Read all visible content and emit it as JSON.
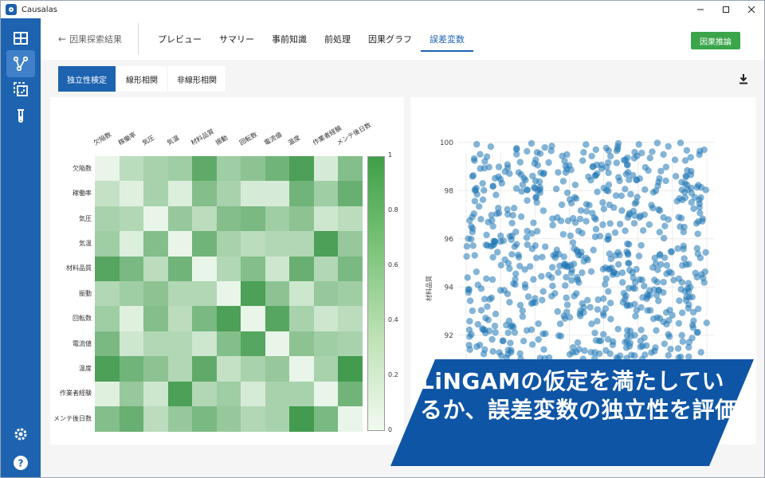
{
  "window": {
    "title": "Causalas"
  },
  "header": {
    "back_label": "因果探索結果",
    "tabs": [
      "プレビュー",
      "サマリー",
      "事前知識",
      "前処理",
      "因果グラフ",
      "誤差変数"
    ],
    "active_tab": 5,
    "primary_button": "因果推論"
  },
  "subtabs": {
    "items": [
      "独立性検定",
      "線形相関",
      "非線形相関"
    ],
    "active": 0
  },
  "colors": {
    "accent": "#1d63b0",
    "rail": "#1d63b0",
    "primary_button": "#3aa54a",
    "banner": "#0e55a5"
  },
  "heatmap": {
    "variables": [
      "欠陥数",
      "稼働率",
      "気圧",
      "気温",
      "材料品質",
      "振動",
      "回転数",
      "電流値",
      "温度",
      "作業者経験",
      "メンテ後日数"
    ],
    "values": [
      [
        0.05,
        0.3,
        0.4,
        0.45,
        0.8,
        0.45,
        0.55,
        0.7,
        0.9,
        0.15,
        0.6
      ],
      [
        0.25,
        0.1,
        0.4,
        0.12,
        0.6,
        0.4,
        0.15,
        0.15,
        0.7,
        0.45,
        0.75
      ],
      [
        0.4,
        0.35,
        0.05,
        0.5,
        0.3,
        0.6,
        0.65,
        0.45,
        0.55,
        0.2,
        0.3
      ],
      [
        0.45,
        0.12,
        0.6,
        0.05,
        0.7,
        0.4,
        0.3,
        0.35,
        0.35,
        0.9,
        0.5
      ],
      [
        0.85,
        0.65,
        0.3,
        0.7,
        0.05,
        0.35,
        0.6,
        0.2,
        0.75,
        0.35,
        0.65
      ],
      [
        0.35,
        0.45,
        0.55,
        0.35,
        0.35,
        0.05,
        0.9,
        0.55,
        0.2,
        0.5,
        0.45
      ],
      [
        0.45,
        0.1,
        0.6,
        0.3,
        0.65,
        0.9,
        0.05,
        0.85,
        0.4,
        0.2,
        0.3
      ],
      [
        0.65,
        0.2,
        0.35,
        0.35,
        0.2,
        0.6,
        0.85,
        0.05,
        0.55,
        0.45,
        0.4
      ],
      [
        0.9,
        0.7,
        0.55,
        0.35,
        0.8,
        0.25,
        0.4,
        0.5,
        0.05,
        0.4,
        0.95
      ],
      [
        0.1,
        0.5,
        0.2,
        0.9,
        0.35,
        0.45,
        0.15,
        0.4,
        0.4,
        0.05,
        0.7
      ],
      [
        0.6,
        0.75,
        0.3,
        0.5,
        0.65,
        0.5,
        0.35,
        0.4,
        0.95,
        0.65,
        0.05
      ]
    ],
    "colorbar_ticks": [
      "0",
      "0.2",
      "0.4",
      "0.6",
      "0.8",
      "1"
    ]
  },
  "chart_data": {
    "type": "scatter",
    "ylabel": "材料品質",
    "y_ticks": [
      "92",
      "94",
      "96",
      "98",
      "100"
    ],
    "ylim": [
      91,
      100
    ],
    "xlim": [
      0,
      1
    ],
    "point_color": "#1f77b4",
    "point_count": 700
  },
  "banner": {
    "text": "LiNGAMの仮定を満たしているか、誤差変数の独立性を評価"
  }
}
